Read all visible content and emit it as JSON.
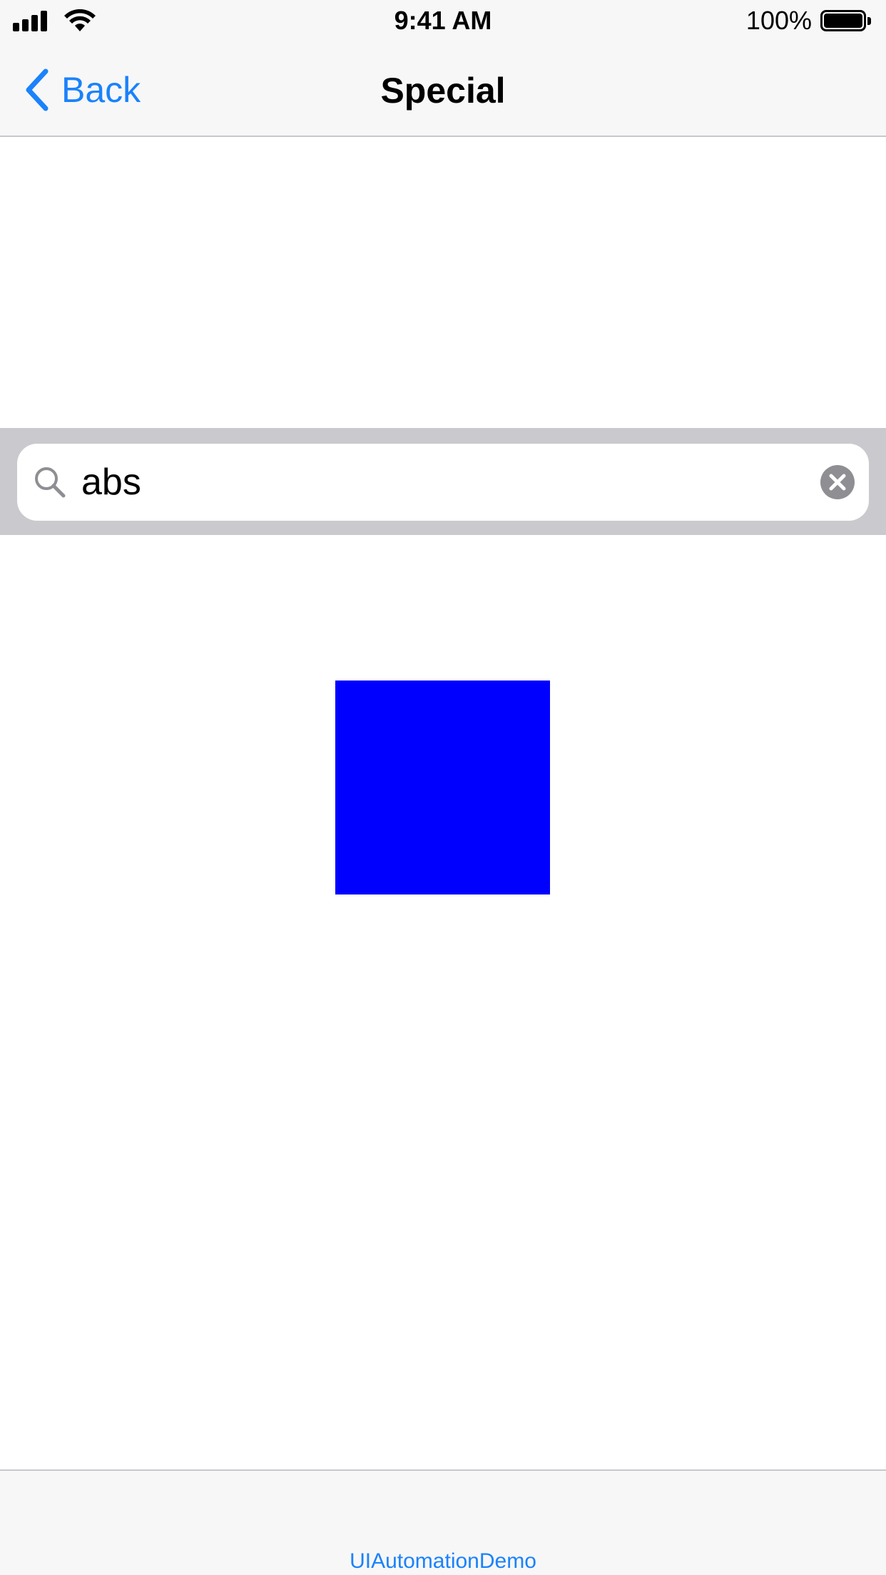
{
  "status_bar": {
    "time": "9:41 AM",
    "battery": "100%",
    "icons": [
      "signal-icon",
      "wifi-icon",
      "battery-icon"
    ]
  },
  "nav": {
    "back_label": "Back",
    "title": "Special",
    "back_icon": "chevron-left-icon"
  },
  "search": {
    "value": "abs",
    "search_icon": "search-icon",
    "clear_icon": "clear-icon"
  },
  "content": {
    "square_color": "#0000ff"
  },
  "tab_bar": {
    "item_label": "UIAutomationDemo"
  },
  "colors": {
    "accent": "#1a82fb",
    "bar_background": "#f7f7f7",
    "search_bar_background": "#c9c9ce"
  }
}
